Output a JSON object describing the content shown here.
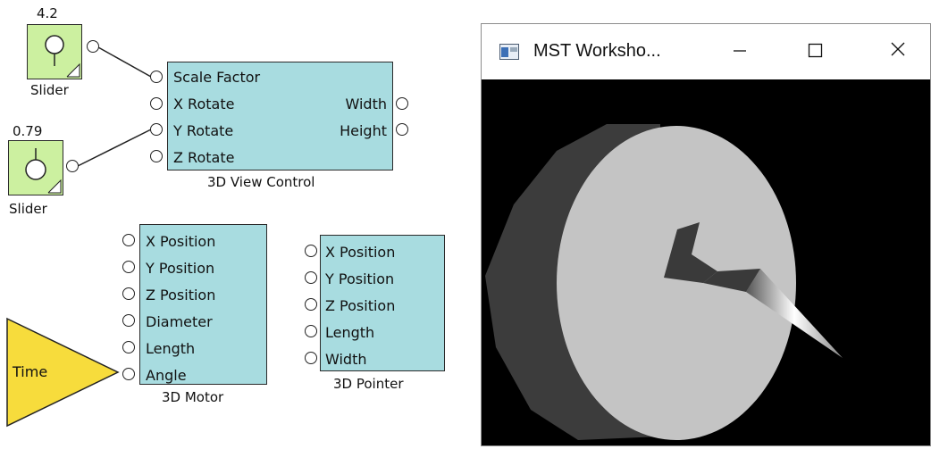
{
  "view_control": {
    "inputs": [
      "Scale Factor",
      "X Rotate",
      "Y Rotate",
      "Z Rotate"
    ],
    "outputs": [
      "Width",
      "Height"
    ],
    "caption": "3D View Control"
  },
  "slider1": {
    "value": "4.2",
    "caption": "Slider"
  },
  "slider2": {
    "value": "0.79",
    "caption": "Slider"
  },
  "motor": {
    "inputs": [
      "X Position",
      "Y Position",
      "Z Position",
      "Diameter",
      "Length",
      "Angle"
    ],
    "caption": "3D Motor"
  },
  "pointer": {
    "inputs": [
      "X Position",
      "Y Position",
      "Z Position",
      "Length",
      "Width"
    ],
    "caption": "3D Pointer"
  },
  "time_block": {
    "label": "Time",
    "color": "#f7dc3c"
  },
  "window": {
    "title": "MST Worksho...",
    "minimize_icon": "minimize-icon",
    "maximize_icon": "maximize-icon",
    "close_icon": "close-icon"
  },
  "colors": {
    "block": "#a8dce0",
    "slider": "#ccf0a0",
    "viewport": "#000000"
  }
}
